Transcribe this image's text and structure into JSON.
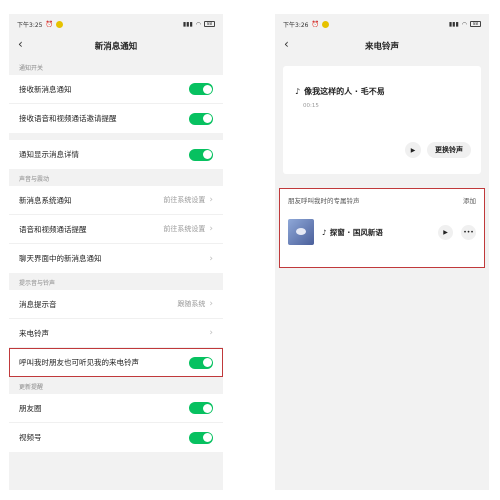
{
  "left": {
    "status_time": "下午3:25",
    "status_icons": "⁂ ⁂ ⌂",
    "battery": "88",
    "title": "新消息通知",
    "sections": [
      {
        "label": "通知开关",
        "groups": [
          [
            {
              "label": "接收新消息通知",
              "type": "toggle",
              "on": true
            },
            {
              "label": "接收语音和视频通话邀请提醒",
              "type": "toggle",
              "on": true
            }
          ],
          [
            {
              "label": "通知显示消息详情",
              "type": "toggle",
              "on": true
            }
          ]
        ]
      },
      {
        "label": "声音与震动",
        "groups": [
          [
            {
              "label": "新消息系统通知",
              "type": "link",
              "value": "前往系统设置"
            },
            {
              "label": "语音和视频通话提醒",
              "type": "link",
              "value": "前往系统设置"
            },
            {
              "label": "聊天界面中的新消息通知",
              "type": "link",
              "value": ""
            }
          ]
        ]
      },
      {
        "label": "提示音与铃声",
        "groups": [
          [
            {
              "label": "消息提示音",
              "type": "link",
              "value": "跟随系统"
            },
            {
              "label": "来电铃声",
              "type": "link",
              "value": ""
            },
            {
              "label": "呼叫我时朋友也可听见我的来电铃声",
              "type": "toggle",
              "on": true,
              "highlight": true
            }
          ]
        ]
      },
      {
        "label": "更新提醒",
        "groups": [
          [
            {
              "label": "朋友圈",
              "type": "toggle",
              "on": true
            },
            {
              "label": "视频号",
              "type": "toggle",
              "on": true
            }
          ]
        ]
      }
    ]
  },
  "right": {
    "status_time": "下午3:26",
    "battery": "88",
    "title": "来电铃声",
    "current_song": "像我这样的人 · 毛不易",
    "current_time": "00:15",
    "change_button": "更换铃声",
    "special_title": "朋友呼叫我时的专属铃声",
    "special_add": "添加",
    "special_song": "探窗 · 国风新语"
  },
  "colors": {
    "toggle_on": "#07c160",
    "highlight": "#c0393b",
    "background": "#f2f2f2"
  }
}
